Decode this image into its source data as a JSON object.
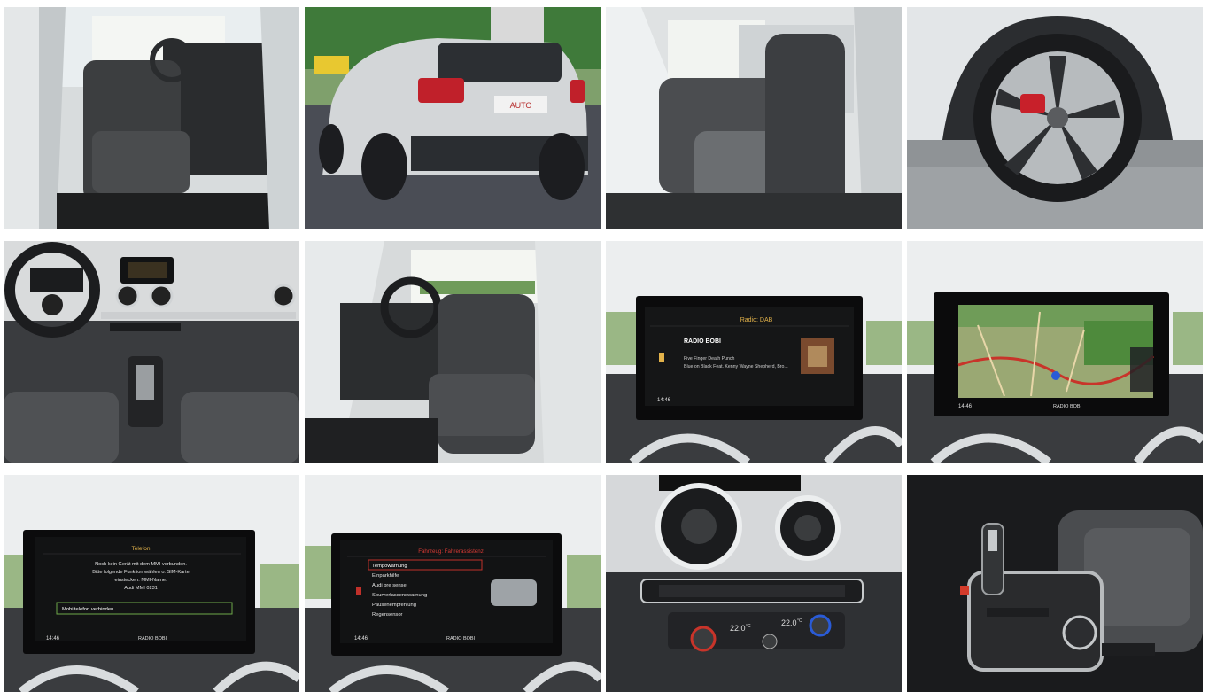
{
  "gallery": {
    "tiles": [
      {
        "id": "interior-front-door"
      },
      {
        "id": "exterior-rear"
      },
      {
        "id": "rear-seats"
      },
      {
        "id": "wheel"
      },
      {
        "id": "dashboard"
      },
      {
        "id": "driver-seat"
      },
      {
        "id": "radio-screen"
      },
      {
        "id": "navigation-screen"
      },
      {
        "id": "telefon-screen"
      },
      {
        "id": "assist-screen"
      },
      {
        "id": "climate-control"
      },
      {
        "id": "gear-shift"
      }
    ]
  },
  "radio": {
    "header": "Radio: DAB",
    "station": "RADIO BOBI",
    "line1": "Five Finger Death Punch",
    "line2": "Blue on Black Feat. Kenny Wayne Shepherd, Bro...",
    "time": "14:46"
  },
  "navigation": {
    "time": "14:46",
    "source": "RADIO BOBI"
  },
  "telefon": {
    "header": "Telefon",
    "message": [
      "Noch kein Gerät mit dem MMI verbunden.",
      "Bitte folgende Funktion wählen o. SIM-Karte",
      "einstecken. MMI-Name:",
      "Audi MMI 0231"
    ],
    "option": "Mobiltelefon verbinden",
    "time": "14:46",
    "source": "RADIO BOBI"
  },
  "assist": {
    "header": "Fahrzeug: Fahrerassistenz",
    "items": [
      "Tempowarnung",
      "Einparkhilfe",
      "Audi pre sense",
      "Spurverlassenswarnung",
      "Pausenempfehlung",
      "Regensensor"
    ],
    "time": "14:46",
    "source": "RADIO BOBI"
  },
  "climate": {
    "left_temp": "22.0",
    "right_temp": "22.0",
    "unit": "°C"
  },
  "exterior": {
    "plate": "AUTO"
  }
}
